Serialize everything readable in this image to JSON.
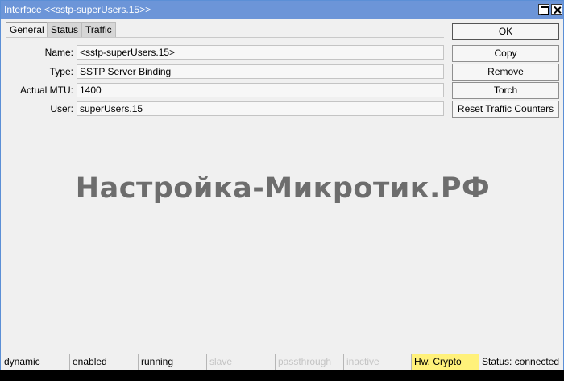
{
  "window": {
    "title": "Interface <<sstp-superUsers.15>>"
  },
  "tabs": [
    {
      "label": "General"
    },
    {
      "label": "Status"
    },
    {
      "label": "Traffic"
    }
  ],
  "fields": {
    "name": {
      "label": "Name:",
      "value": "<sstp-superUsers.15>"
    },
    "type": {
      "label": "Type:",
      "value": "SSTP Server Binding"
    },
    "mtu": {
      "label": "Actual MTU:",
      "value": "1400"
    },
    "user": {
      "label": "User:",
      "value": "superUsers.15"
    }
  },
  "buttons": {
    "ok": "OK",
    "copy": "Copy",
    "remove": "Remove",
    "torch": "Torch",
    "reset": "Reset Traffic Counters"
  },
  "watermark": "Настройка-Микротик.РФ",
  "status": {
    "dynamic": "dynamic",
    "enabled": "enabled",
    "running": "running",
    "slave": "slave",
    "passthrough": "passthrough",
    "inactive": "inactive",
    "hw_crypto": "Hw. Crypto",
    "connection": "Status: connected"
  },
  "colors": {
    "titlebar": "#6c95d8",
    "highlight": "#fff17a"
  }
}
